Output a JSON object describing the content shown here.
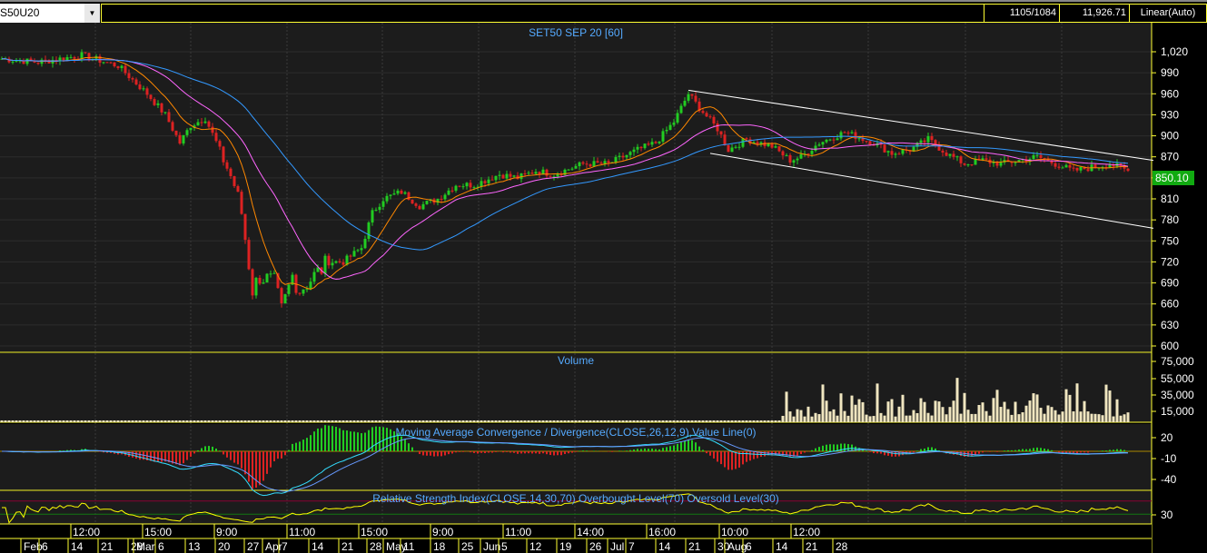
{
  "toolbar": {
    "symbol": "S50U20",
    "counter": "1105/1084",
    "value": "11,926.71",
    "scale_mode": "Linear(Auto)"
  },
  "colors": {
    "up": "#22cc22",
    "down": "#dd2222",
    "ma_fast": "#ff8800",
    "ma_mid": "#ff66ff",
    "ma_slow": "#3399ff",
    "volume": "#f0e6c0",
    "axis": "#ffff33",
    "title": "#55aaff",
    "last_price_bg": "#11aa11"
  },
  "chart_data": {
    "type": "candlestick",
    "title": "SET50 SEP 20   [60]",
    "last_price": "850.10",
    "price_ticks": [
      "600",
      "630",
      "660",
      "690",
      "720",
      "750",
      "780",
      "810",
      "840",
      "870",
      "900",
      "930",
      "960",
      "990",
      "1,020"
    ],
    "ylim": [
      600,
      1020
    ],
    "close_path": [
      [
        0,
        1010
      ],
      [
        10,
        1005
      ],
      [
        22,
        1015
      ],
      [
        32,
        1000
      ],
      [
        40,
        960
      ],
      [
        45,
        930
      ],
      [
        49,
        890
      ],
      [
        52,
        915
      ],
      [
        56,
        925
      ],
      [
        60,
        880
      ],
      [
        64,
        830
      ],
      [
        66,
        790
      ],
      [
        69,
        680
      ],
      [
        71,
        700
      ],
      [
        75,
        690
      ],
      [
        77,
        650
      ],
      [
        80,
        700
      ],
      [
        82,
        680
      ],
      [
        86,
        700
      ],
      [
        90,
        720
      ],
      [
        94,
        720
      ],
      [
        99,
        740
      ],
      [
        102,
        790
      ],
      [
        105,
        810
      ],
      [
        110,
        820
      ],
      [
        115,
        800
      ],
      [
        120,
        810
      ],
      [
        125,
        830
      ],
      [
        130,
        830
      ],
      [
        137,
        845
      ],
      [
        142,
        840
      ],
      [
        147,
        850
      ],
      [
        152,
        845
      ],
      [
        160,
        860
      ],
      [
        167,
        860
      ],
      [
        175,
        880
      ],
      [
        180,
        890
      ],
      [
        185,
        920
      ],
      [
        189,
        960
      ],
      [
        192,
        940
      ],
      [
        197,
        910
      ],
      [
        200,
        880
      ],
      [
        205,
        895
      ],
      [
        212,
        885
      ],
      [
        217,
        865
      ],
      [
        220,
        870
      ],
      [
        225,
        890
      ],
      [
        232,
        905
      ],
      [
        240,
        890
      ],
      [
        245,
        875
      ],
      [
        250,
        880
      ],
      [
        255,
        895
      ],
      [
        260,
        875
      ],
      [
        265,
        860
      ],
      [
        270,
        865
      ],
      [
        275,
        860
      ],
      [
        280,
        865
      ],
      [
        285,
        870
      ],
      [
        290,
        860
      ],
      [
        295,
        850
      ],
      [
        300,
        855
      ],
      [
        305,
        860
      ],
      [
        310,
        850
      ]
    ],
    "trend_lines": [
      {
        "from": [
          189,
          965
        ],
        "to": [
          317,
          865
        ]
      },
      {
        "from": [
          195,
          875
        ],
        "to": [
          317,
          768
        ]
      }
    ],
    "volume": {
      "title": "Volume",
      "ticks": [
        "75,000",
        "55,000",
        "35,000",
        "15,000"
      ],
      "low_until_bar": 215,
      "range": [
        15000,
        80000
      ]
    },
    "macd": {
      "title": "Moving Average Convergence / Divergence(CLOSE,26,12,9),Value Line(0)",
      "ticks": [
        "20",
        "-10",
        "-40"
      ]
    },
    "rsi": {
      "title": "Relative Strength Index(CLOSE,14,30,70) Overbought Level(70) Oversold Level(30)",
      "ticks": [
        "30"
      ]
    },
    "time_labels": [
      "12:00",
      "15:00",
      "9:00",
      "11:00",
      "15:00",
      "9:00",
      "11:00",
      "14:00",
      "16:00",
      "10:00",
      "12:00"
    ],
    "date_labels": [
      "Feb",
      "6",
      "14",
      "21",
      "28",
      "Mar",
      "6",
      "13",
      "20",
      "27",
      "Apr",
      "7",
      "14",
      "21",
      "28",
      "May",
      "11",
      "18",
      "25",
      "Jun",
      "5",
      "12",
      "19",
      "26",
      "Jul",
      "7",
      "14",
      "21",
      "30",
      "Aug",
      "6",
      "14",
      "21",
      "28"
    ]
  }
}
